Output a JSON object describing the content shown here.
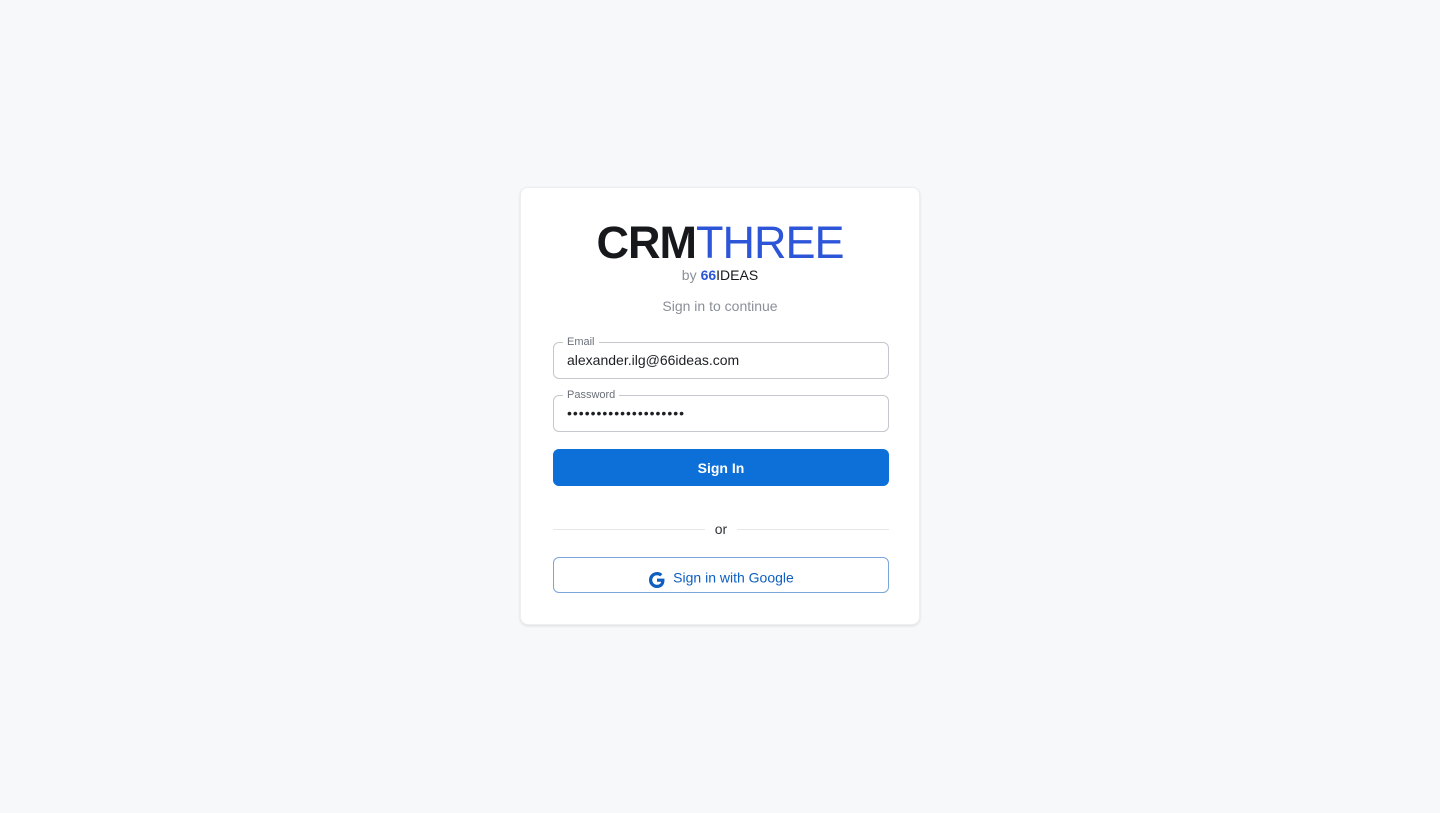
{
  "logo": {
    "main_bold": "CRM",
    "main_light": "THREE",
    "by": "by",
    "brand_66": "66",
    "brand_ideas": "IDEAS"
  },
  "subtitle": "Sign in to continue",
  "form": {
    "email": {
      "label": "Email",
      "value": "alexander.ilg@66ideas.com"
    },
    "password": {
      "label": "Password",
      "value": "••••••••••••••••••••"
    },
    "signin_label": "Sign In",
    "divider_text": "or",
    "google_label": "Sign in with Google"
  },
  "colors": {
    "background": "#f7f8fa",
    "primary": "#0d6fd8",
    "brand_blue": "#2c55d8",
    "text_dark": "#17181c",
    "text_muted": "#8a8f98"
  },
  "icons": {
    "google": "google-g-icon"
  }
}
